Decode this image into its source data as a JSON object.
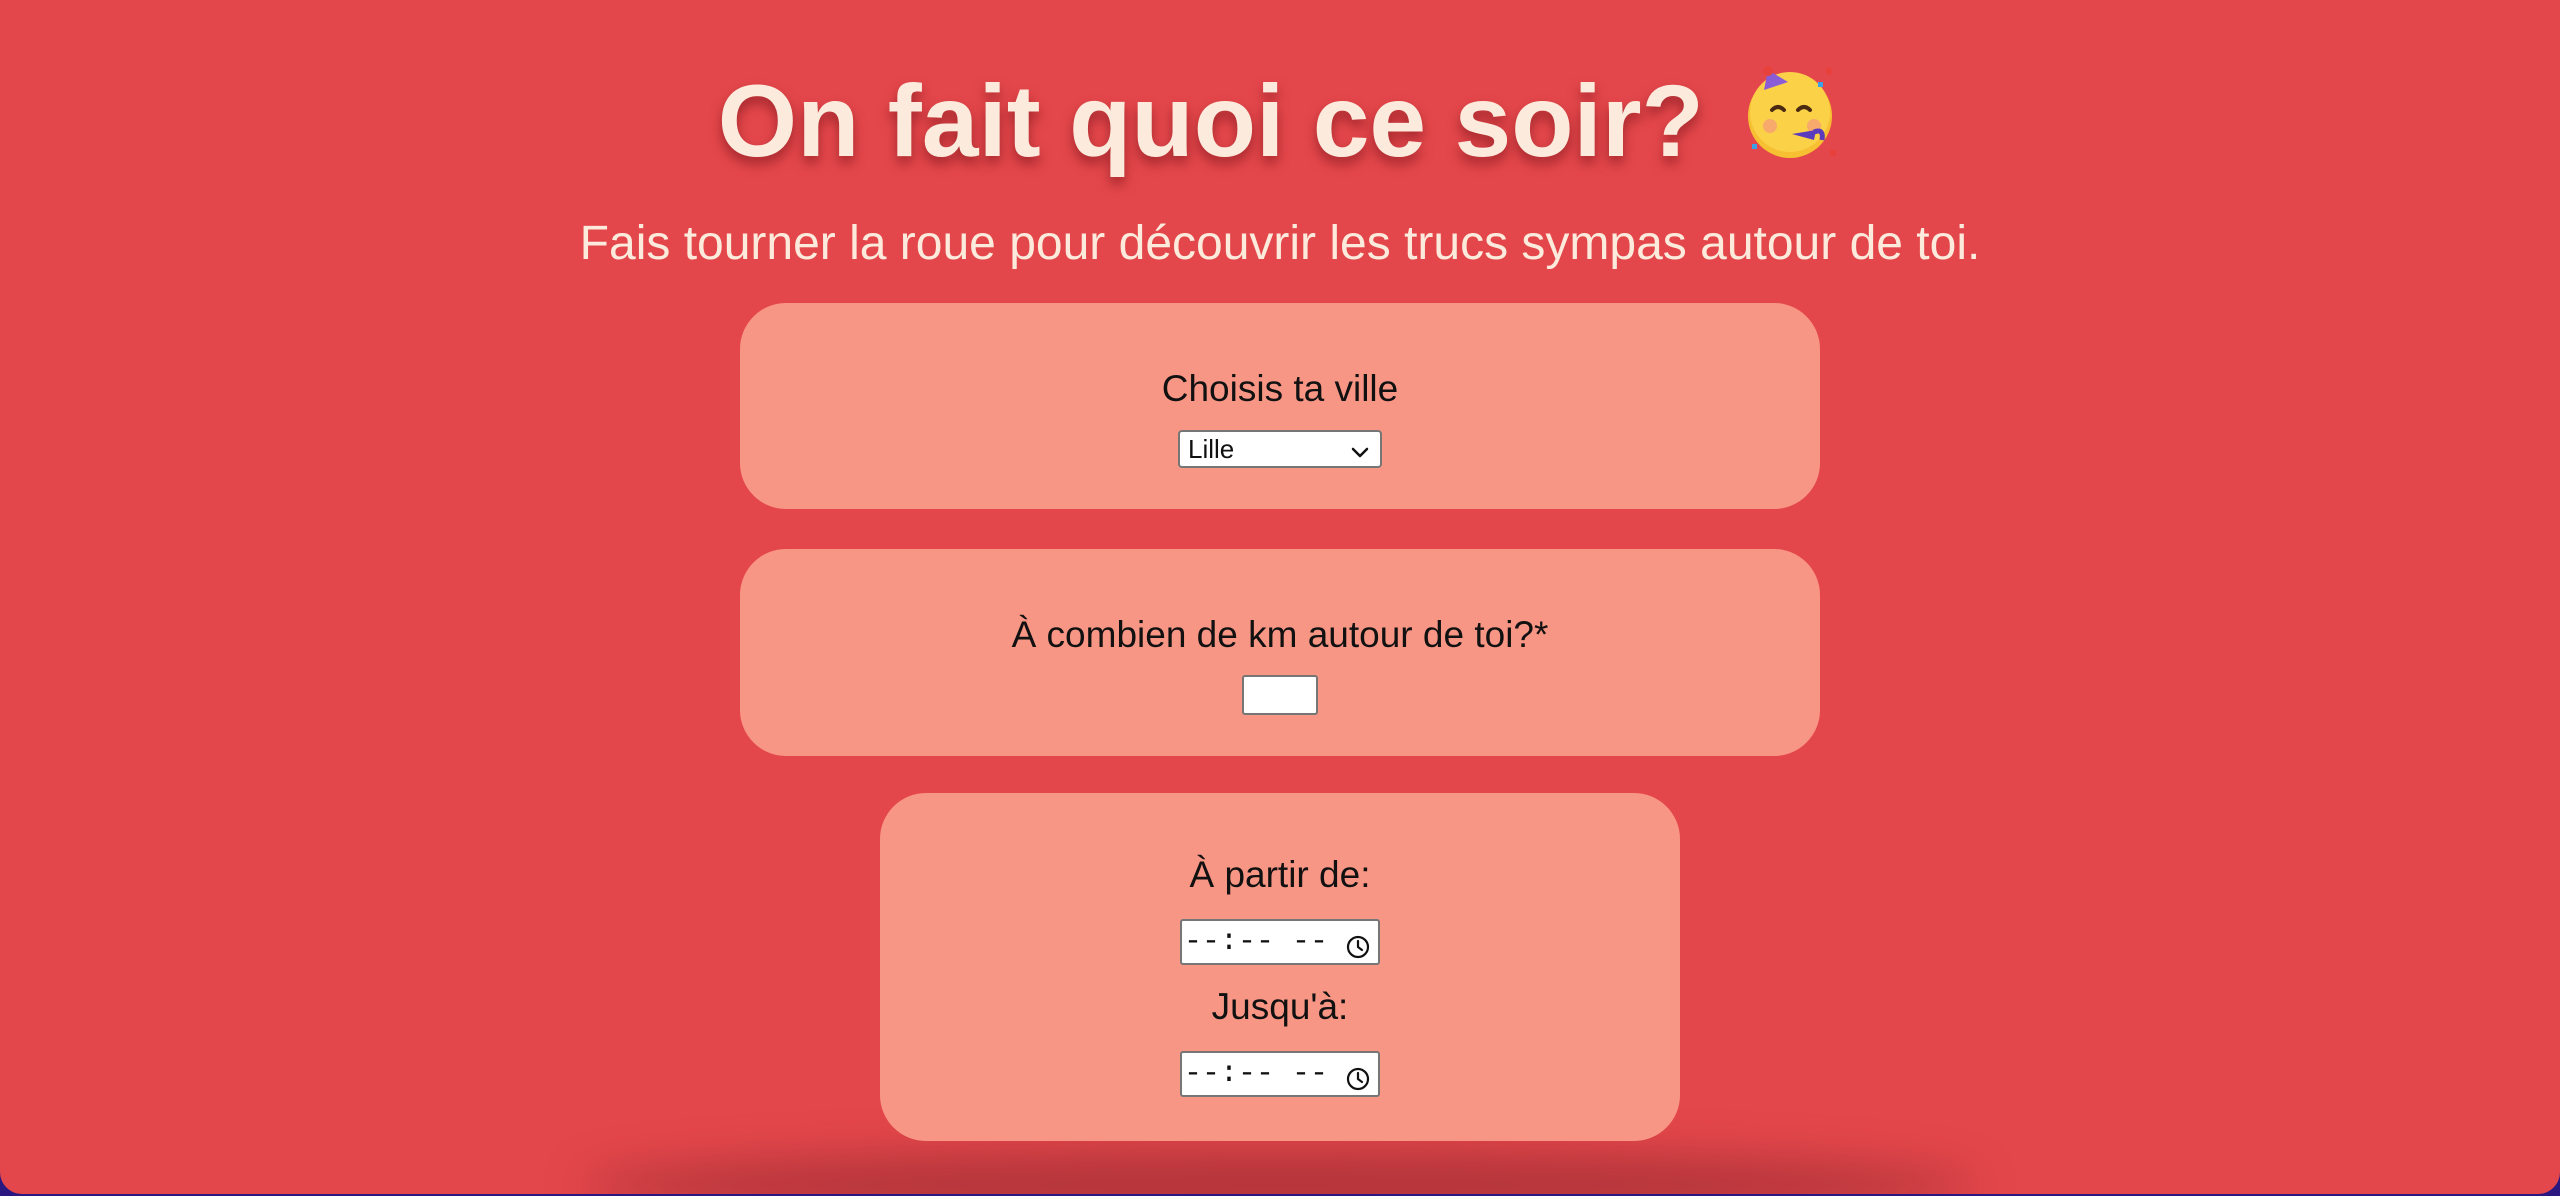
{
  "header": {
    "title": "On fait quoi ce soir?",
    "title_emoji": "partying-face-emoji",
    "subtitle": "Fais tourner la roue pour découvrir les trucs sympas autour de toi."
  },
  "city": {
    "label": "Choisis ta ville",
    "selected": "Lille"
  },
  "distance": {
    "label": "À combien de km autour de toi?*",
    "value": ""
  },
  "time": {
    "from_label": "À partir de:",
    "from_value": "--:-- --",
    "to_label": "Jusqu'à:",
    "to_value": "--:-- --"
  },
  "colors": {
    "page_background": "#e4474b",
    "card_background": "#f89685",
    "title_color": "#fcebdc",
    "outer_background": "#2a1780"
  }
}
